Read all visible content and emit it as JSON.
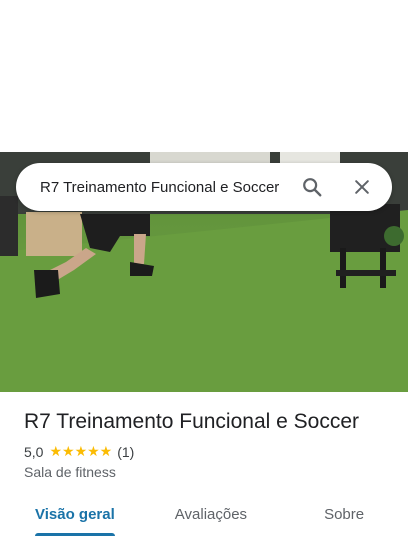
{
  "search": {
    "query": "R7 Treinamento Funcional e Soccer"
  },
  "place": {
    "name": "R7 Treinamento Funcional e Soccer",
    "rating": "5,0",
    "stars": "★★★★★",
    "review_count": "(1)",
    "category": "Sala de fitness"
  },
  "tabs": [
    {
      "label": "Visão geral"
    },
    {
      "label": "Avaliações"
    },
    {
      "label": "Sobre"
    }
  ],
  "colors": {
    "accent": "#1a73a8",
    "star": "#fbbc04",
    "turf": "#6a9e3f"
  },
  "icons": {
    "search": "search-icon",
    "close": "close-icon"
  }
}
